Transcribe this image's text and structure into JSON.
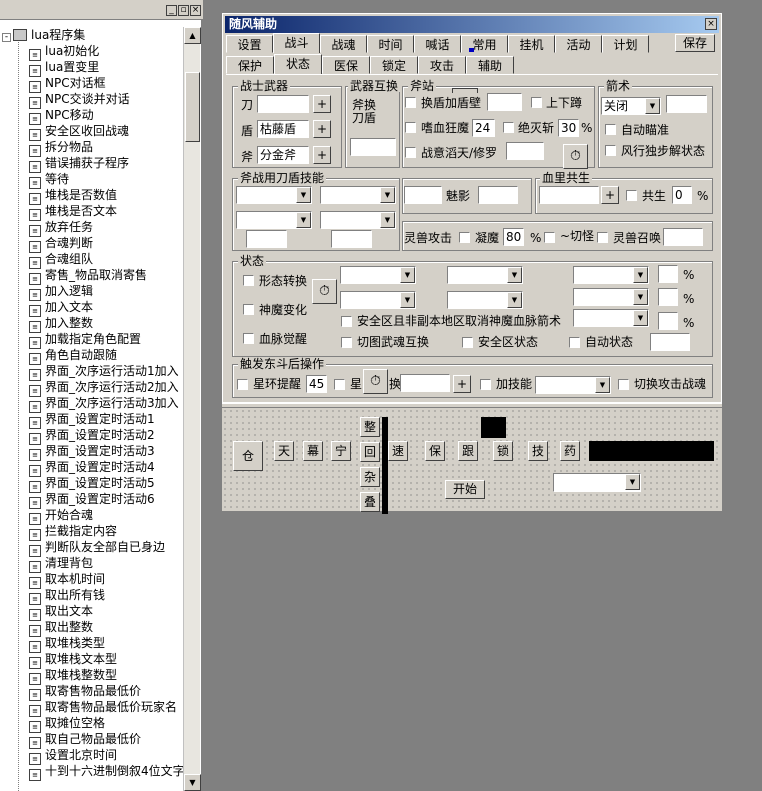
{
  "tree": {
    "root_label": "lua程序集",
    "items": [
      "lua初始化",
      "lua置变里",
      "NPC对话框",
      "NPC交谈并对话",
      "NPC移动",
      "安全区收回战魂",
      "拆分物品",
      "错误捕获子程序",
      "等待",
      "堆栈是否数值",
      "堆栈是否文本",
      "放弃任务",
      "合魂判断",
      "合魂组队",
      "寄售_物品取消寄售",
      "加入逻辑",
      "加入文本",
      "加入整数",
      "加载指定角色配置",
      "角色自动跟随",
      "界面_次序运行活动1加入",
      "界面_次序运行活动2加入",
      "界面_次序运行活动3加入",
      "界面_设置定时活动1",
      "界面_设置定时活动2",
      "界面_设置定时活动3",
      "界面_设置定时活动4",
      "界面_设置定时活动5",
      "界面_设置定时活动6",
      "开始合魂",
      "拦截指定内容",
      "判断队友全部自已身边",
      "清理背包",
      "取本机时间",
      "取出所有钱",
      "取出文本",
      "取出整数",
      "取堆栈类型",
      "取堆栈文本型",
      "取堆栈整数型",
      "取寄售物品最低价",
      "取寄售物品最低价玩家名",
      "取摊位空格",
      "取自己物品最低价",
      "设置北京时间",
      "十到十六进制倒叙4位文字"
    ]
  },
  "window": {
    "title": "随风辅助",
    "close": "×",
    "tabs_row1": [
      "设置",
      "战斗",
      "战魂",
      "时间",
      "喊话",
      "常用",
      "挂机",
      "活动",
      "计划"
    ],
    "save_btn": "保存",
    "tabs_row2": [
      "保护",
      "状态",
      "医保",
      "锁定",
      "攻击",
      "辅助"
    ]
  },
  "weapons": {
    "title": "战士武器",
    "blade_lbl": "刀",
    "shield_lbl": "盾",
    "shield_val": "枯藤盾",
    "axe_lbl": "斧",
    "axe_val": "分金斧",
    "plus": "+"
  },
  "swap": {
    "title": "武器互换",
    "line1": "斧换",
    "line2": "刀盾"
  },
  "axestance": {
    "title": "斧站",
    "opt1": "换盾加盾壁",
    "opt2": "上下蹲",
    "opt3": "嗜血狂魔",
    "opt3_val": "24",
    "opt4": "绝灭斩",
    "opt4_val": "30",
    "pct": "%",
    "opt5": "战意滔天/修罗"
  },
  "archery": {
    "title": "箭术",
    "mode": "关闭",
    "opt1": "自动瞄准",
    "opt2": "风行独步解状态"
  },
  "axeskills": {
    "title": "斧战用刀盾技能",
    "shadow": "魅影"
  },
  "bloodshare": {
    "title": "血里共生",
    "opt": "共生",
    "val": "0",
    "pct": "%"
  },
  "beast": {
    "attack": "灵兽攻击",
    "ning": "凝魔",
    "ning_val": "80",
    "pct": "%",
    "qie": "~切怪",
    "summon": "灵兽召唤"
  },
  "status": {
    "title": "状态",
    "form": "形态转换",
    "demon": "神魔变化",
    "blood": "血脉觉醒",
    "safe_cancel": "安全区且非副本地区取消神魔血脉箭术",
    "switch_soul": "切图武魂互换",
    "safe_status": "安全区状态",
    "auto_status": "自动状态",
    "pct": "%"
  },
  "trigger": {
    "title": "触发东斗后操作",
    "star_alert": "星环提醒",
    "star_val": "45",
    "star2": "星",
    "swap": "换",
    "add_skill": "加技能",
    "switch_attack": "切换攻击战魂"
  },
  "bottom": {
    "cang": "仓",
    "tian": "天",
    "mu": "幕",
    "ning": "宁",
    "zheng": "整",
    "hui": "回",
    "za": "杂",
    "die": "叠",
    "su": "速",
    "bao": "保",
    "gen": "跟",
    "suo": "锁",
    "ji": "技",
    "yao": "药",
    "start": "开始"
  }
}
